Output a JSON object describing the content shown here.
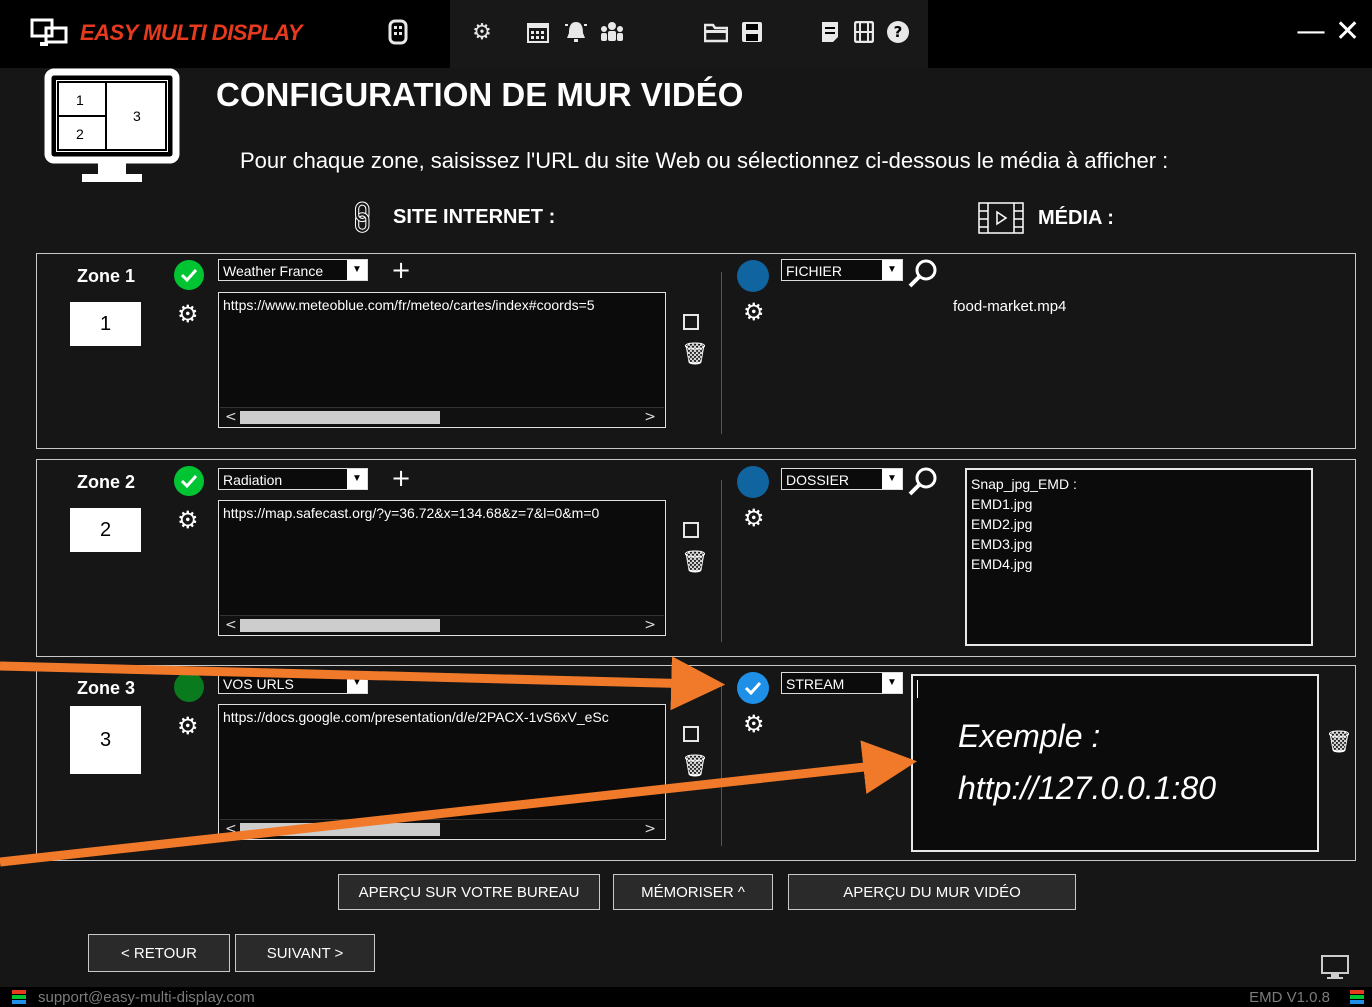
{
  "app": {
    "title": "EASY MULTI DISPLAY",
    "version": "EMD V1.0.8",
    "support_email": "support@easy-multi-display.com"
  },
  "toolbar": {
    "icons": [
      "remote-icon",
      "gear-icon",
      "calendar-icon",
      "alarm-icon",
      "group-icon",
      "folder-icon",
      "save-icon",
      "notes-icon",
      "film-icon",
      "help-icon"
    ],
    "selected": "gear-icon",
    "window_controls": {
      "minimize": "—",
      "close": "✕"
    }
  },
  "header": {
    "title": "CONFIGURATION DE MUR VIDÉO",
    "instruction": "Pour chaque zone, saisissez l'URL du site Web ou sélectionnez ci-dessous le média à afficher :",
    "col_site": "SITE INTERNET :",
    "col_media": "MÉDIA :",
    "layout_cells": [
      "1",
      "2",
      "3"
    ]
  },
  "zones": [
    {
      "label": "Zone 1",
      "number": "1",
      "site_status": "active",
      "site_combo": "Weather France",
      "url": "https://www.meteoblue.com/fr/meteo/cartes/index#coords=5",
      "media_type": "FICHIER",
      "media_file": "food-market.mp4"
    },
    {
      "label": "Zone 2",
      "number": "2",
      "site_status": "active",
      "site_combo": "Radiation",
      "url": "https://map.safecast.org/?y=36.72&x=134.68&z=7&l=0&m=0",
      "media_type": "DOSSIER",
      "media_folder": {
        "title": "Snap_jpg_EMD :",
        "items": [
          "EMD1.jpg",
          "EMD2.jpg",
          "EMD3.jpg",
          "EMD4.jpg"
        ]
      }
    },
    {
      "label": "Zone 3",
      "number": "3",
      "site_status": "inactive",
      "site_combo": "VOS URLS",
      "url": "https://docs.google.com/presentation/d/e/2PACX-1vS6xV_eSc",
      "media_type": "STREAM",
      "media_status": "selected",
      "stream_value": ""
    }
  ],
  "buttons": {
    "preview_desktop": "APERÇU SUR VOTRE BUREAU",
    "memorize": "MÉMORISER ^",
    "preview_wall": "APERÇU DU MUR VIDÉO",
    "back": "< RETOUR",
    "next": "SUIVANT >"
  },
  "annotation": {
    "line1": "Exemple :",
    "line2": "http://127.0.0.1:80",
    "arrow_color": "#f07a2a"
  },
  "colors": {
    "accent_red": "#e63a1e",
    "green": "#00c431",
    "dark_green": "#0a7a1f",
    "blue": "#1064a0",
    "check_blue": "#1e90e8"
  }
}
